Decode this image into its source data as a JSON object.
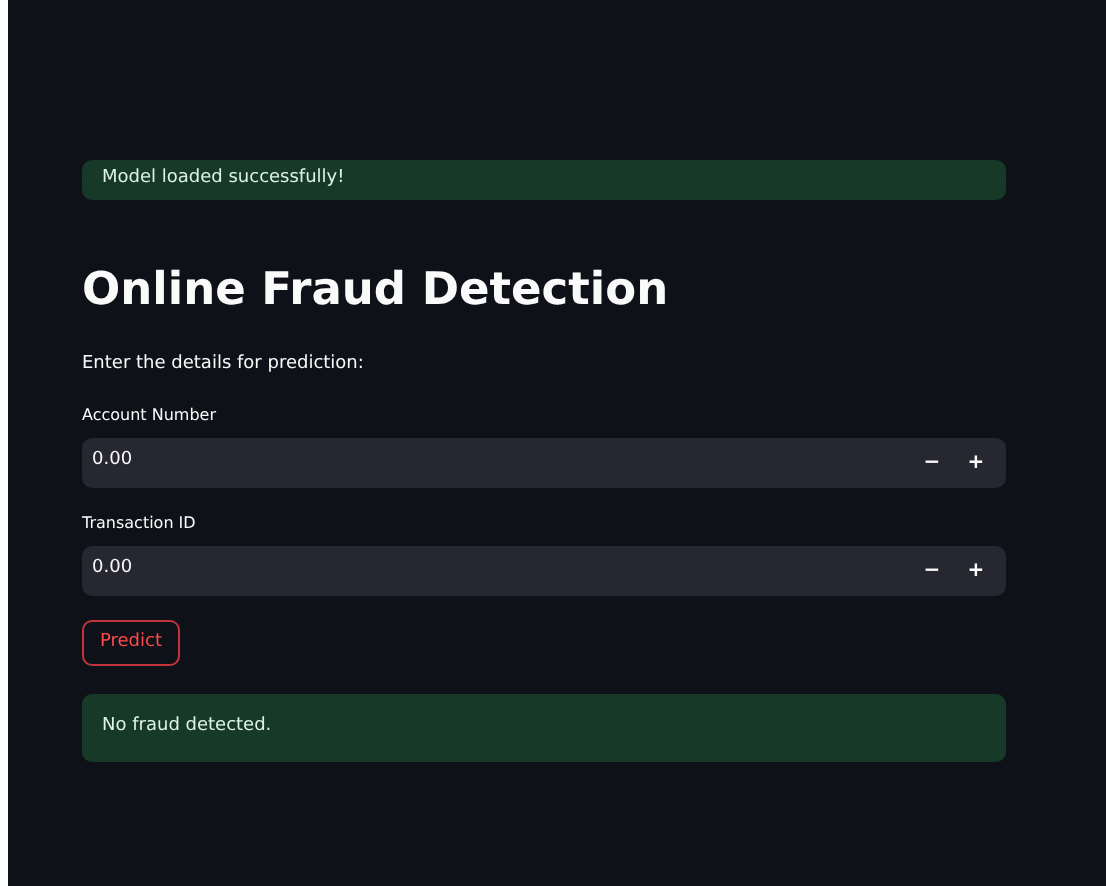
{
  "alerts_top": [
    {
      "kind": "success",
      "text": "Model loaded successfully!"
    }
  ],
  "title": "Online Fraud Detection",
  "subtitle": "Enter the details for prediction:",
  "fields": [
    {
      "label": "Account Number",
      "value": "0.00",
      "minus": "−",
      "plus": "+"
    },
    {
      "label": "Transaction ID",
      "value": "0.00",
      "minus": "−",
      "plus": "+"
    }
  ],
  "button": "Predict",
  "result": {
    "kind": "success",
    "text": "No fraud detected."
  }
}
